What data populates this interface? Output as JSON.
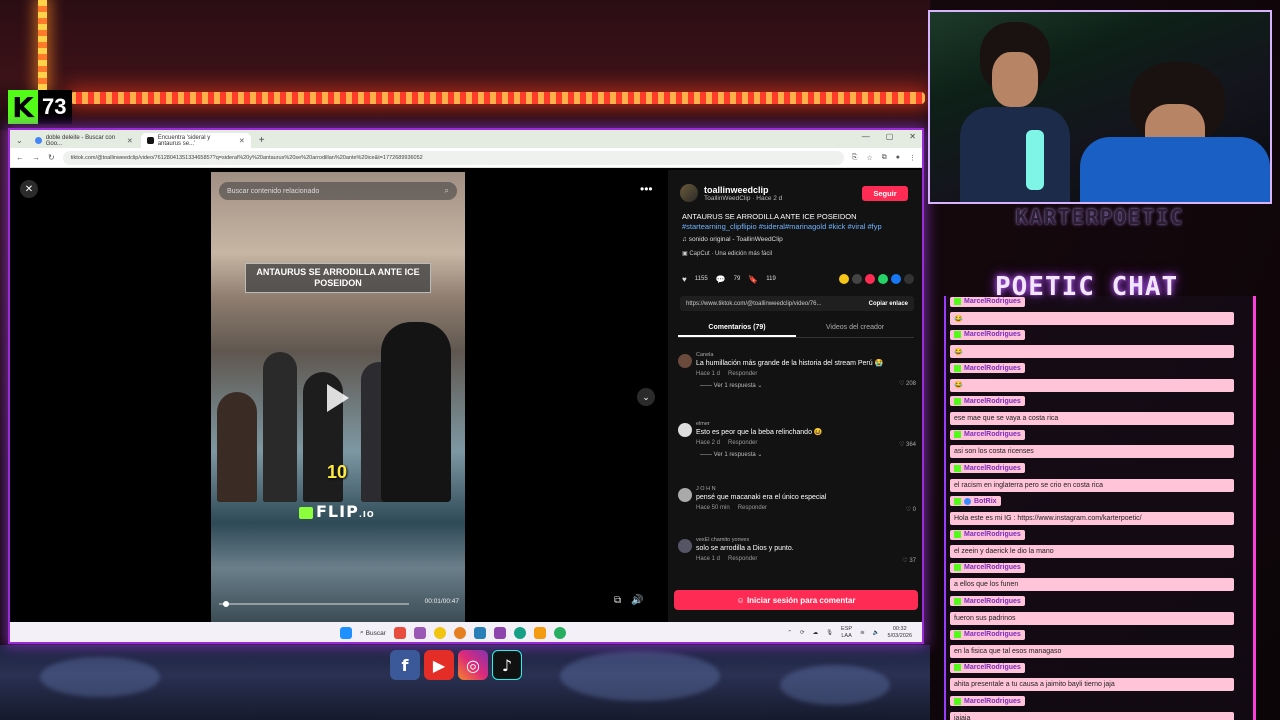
{
  "kick": {
    "viewer_count": "73"
  },
  "browser": {
    "tabs": [
      {
        "label": "doble deleite - Buscar con Goo..."
      },
      {
        "label": "Encuentra 'sideral y antaurus se...' "
      }
    ],
    "url": "tiktok.com/@toallinweedclip/video/7612804135133465857?q=sideral%20y%20antaurus%20se%20arrodillan%20ante%20ice&t=1772689936052"
  },
  "video": {
    "search_placeholder": "Buscar contenido relacionado",
    "caption": "ANTAURUS SE ARRODILLA ANTE ICE POSEIDON",
    "overlay_number": "10",
    "logo": "FLIP",
    "logo_suffix": ".IO",
    "time": "00:01/00:47",
    "progress": 0.02
  },
  "panel": {
    "author_name": "toallinweedclip",
    "author_sub": "ToallinWeedClip · Hace 2 d",
    "follow": "Seguir",
    "desc_title": "ANTAURUS SE ARRODILLA ANTE ICE POSEIDON",
    "desc_tags": "#startearning_clipflipio #sideral#marinagold #kick #viral #fyp",
    "music": "sonido original - ToallinWeedClip",
    "capcut": "CapCut · Una edición más fácil",
    "likes": "1155",
    "comments_count": "79",
    "saves": "119",
    "link": "https://www.tiktok.com/@toallinweedclip/video/76...",
    "copy_link": "Copiar enlace",
    "tab_comments": "Comentarios (79)",
    "tab_creator": "Videos del creador",
    "login": "Iniciar sesión para comentar"
  },
  "comments": [
    {
      "user": "Canela",
      "text": "La humillación más grande de la historia del stream Perú 😭",
      "time": "Hace 1 d",
      "reply": "Responder",
      "likes": "208",
      "replies": "Ver 1 respuesta"
    },
    {
      "user": "elmer",
      "text": "Esto es peor que la beba relinchando 😆",
      "time": "Hace 2 d",
      "reply": "Responder",
      "likes": "364",
      "replies": "Ver 1 respuesta"
    },
    {
      "user": "J O H N",
      "text": "pensé que macanaki era el único especial",
      "time": "Hace 50 min",
      "reply": "Responder",
      "likes": "0",
      "replies": ""
    },
    {
      "user": "vexEl chamito yonvex",
      "text": "solo se arrodilla a Dios y punto.",
      "time": "Hace 1 d",
      "reply": "Responder",
      "likes": "37",
      "replies": ""
    }
  ],
  "taskbar": {
    "search": "Buscar",
    "lang": "ESP\nLAA",
    "time": "00:32",
    "date": "5/03/2026"
  },
  "webcam": {
    "label": "KARTERPOETIC"
  },
  "chat": {
    "title": "POETIC CHAT",
    "messages": [
      {
        "user": "MarcelRodrigues",
        "text": "😂"
      },
      {
        "user": "MarcelRodrigues",
        "text": "😂"
      },
      {
        "user": "MarcelRodrigues",
        "text": "😂"
      },
      {
        "user": "MarcelRodrigues",
        "text": "ese mae que se vaya a costa rica"
      },
      {
        "user": "MarcelRodrigues",
        "text": "asi son los costa ricenses"
      },
      {
        "user": "MarcelRodrigues",
        "text": "el racism en inglaterra pero se crio en costa rica"
      },
      {
        "user": "BotRix",
        "text": "Hola este es mi IG : https://www.instagram.com/karterpoetic/"
      },
      {
        "user": "MarcelRodrigues",
        "text": "el zeein y daerick le dio la mano"
      },
      {
        "user": "MarcelRodrigues",
        "text": "a ellos que los funen"
      },
      {
        "user": "MarcelRodrigues",
        "text": "fueron sus padrinos"
      },
      {
        "user": "MarcelRodrigues",
        "text": "en la fisica que tal esos managaso"
      },
      {
        "user": "MarcelRodrigues",
        "text": "ahita presentale a tu causa a jaimito bayli tierno jaja"
      },
      {
        "user": "MarcelRodrigues",
        "text": "jajaja"
      }
    ]
  }
}
